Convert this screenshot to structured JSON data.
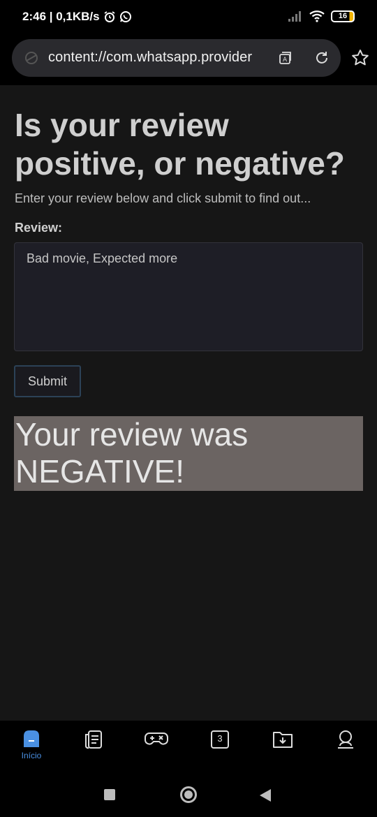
{
  "status_bar": {
    "time_speed": "2:46 | 0,1KB/s",
    "battery": "16"
  },
  "browser": {
    "url": "content://com.whatsapp.provider"
  },
  "page": {
    "title": "Is your review positive, or negative?",
    "subtitle": "Enter your review below and click submit to find out...",
    "review_label": "Review:",
    "review_value": "Bad movie, Expected more",
    "submit_label": "Submit",
    "result_text": "Your review was NEGATIVE!"
  },
  "bottom_nav": {
    "items": [
      {
        "icon": "home-icon",
        "label": "Início",
        "active": true
      },
      {
        "icon": "articles-icon"
      },
      {
        "icon": "games-icon"
      },
      {
        "icon": "tabs-icon",
        "count": "3"
      },
      {
        "icon": "downloads-icon"
      },
      {
        "icon": "profile-icon"
      }
    ]
  },
  "colors": {
    "accent": "#4a90e2",
    "result_bg": "#6b6462",
    "page_bg": "#161616"
  }
}
